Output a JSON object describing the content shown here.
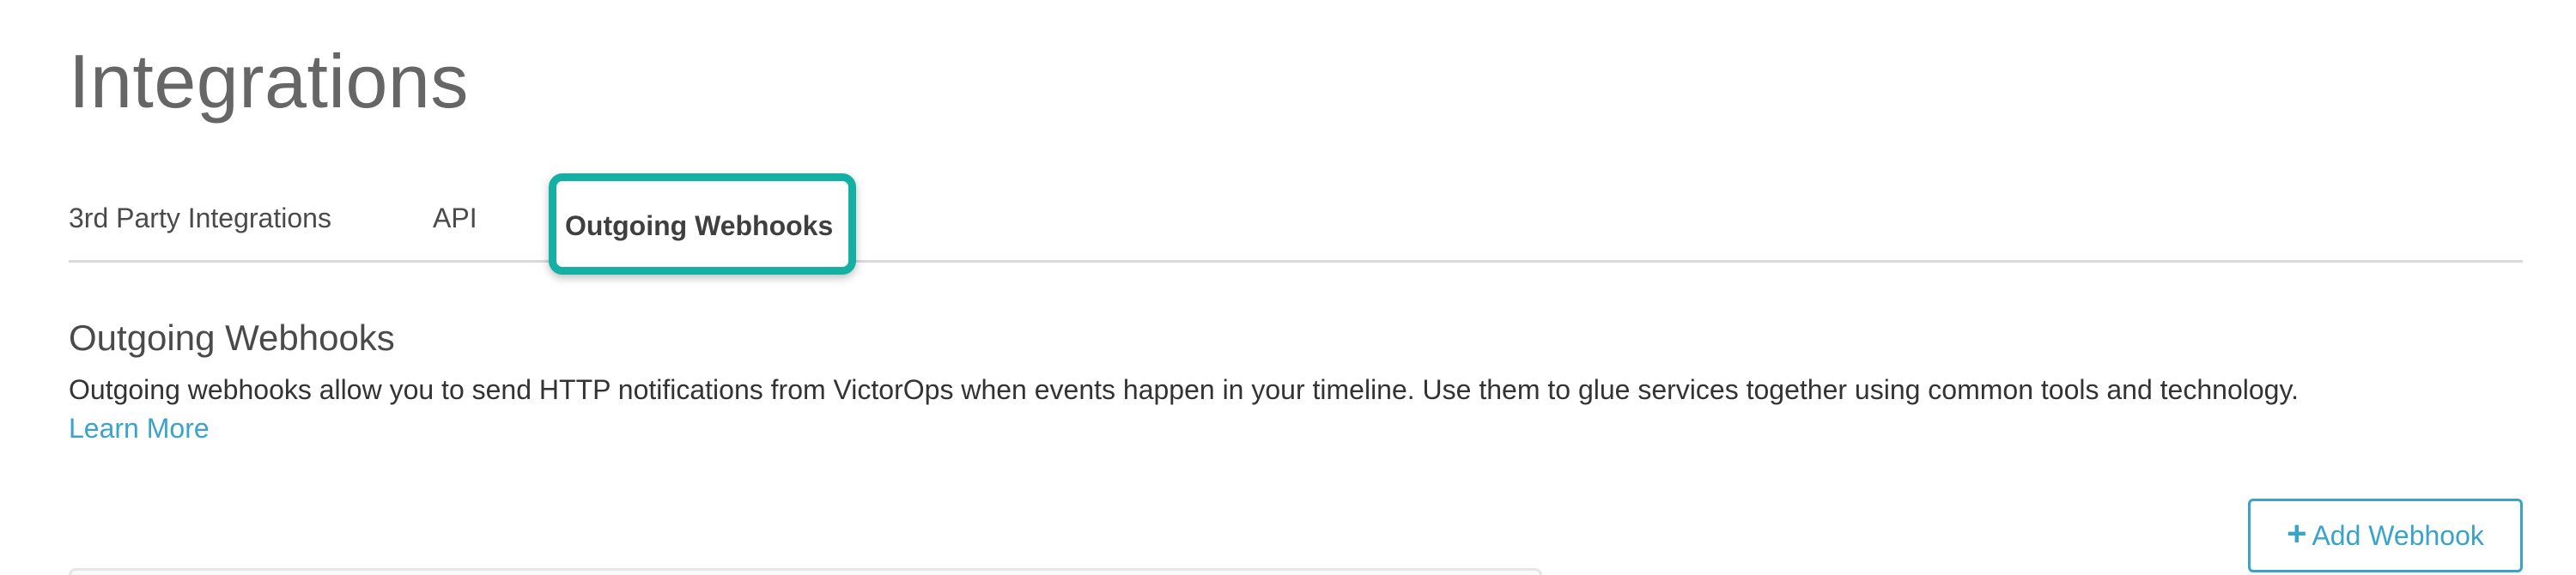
{
  "page": {
    "title": "Integrations"
  },
  "tabs": [
    {
      "label": "3rd Party Integrations",
      "active": false
    },
    {
      "label": "API",
      "active": false
    },
    {
      "label": "Outgoing Webhooks",
      "active": true
    }
  ],
  "section": {
    "title": "Outgoing Webhooks",
    "description": "Outgoing webhooks allow you to send HTTP notifications from VictorOps when events happen in your timeline. Use them to glue services together using common tools and technology.",
    "learn_more": "Learn More"
  },
  "actions": {
    "add_webhook_label": "Add Webhook",
    "add_webhook_icon": "plus-icon"
  },
  "colors": {
    "accent": "#3aa3c9",
    "highlight": "#14b0a4",
    "divider": "#d9d9d9"
  }
}
